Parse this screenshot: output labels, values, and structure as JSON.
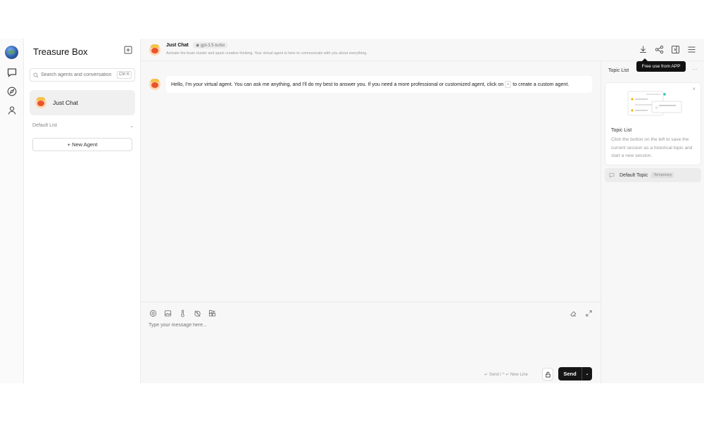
{
  "sidebar": {
    "title": "Treasure Box",
    "search": {
      "placeholder": "Search agents and conversations",
      "shortcut": "Ctrl K"
    },
    "active_session": "Just Chat",
    "group": {
      "label": "Default List"
    },
    "new_agent_label": "+ New Agent"
  },
  "chat": {
    "title": "Just Chat",
    "model": "gpt-3.5-turbo",
    "description": "Activate the brain cluster and spark creative thinking. Your virtual agent is here to communicate with you about everything.",
    "message": {
      "text_before": "Hello, I'm your virtual agent. You can ask me anything, and I'll do my best to answer you. If you need a more professional or customized agent, click on",
      "inline_tag": "+",
      "text_after": "to create a custom agent."
    },
    "input": {
      "placeholder": "Type your message here...",
      "hint": "↵ Send / ^ ↵ New Line",
      "send_label": "Send"
    }
  },
  "toolbar": {
    "tooltip": "Free use from APP"
  },
  "topics": {
    "heading": "Topic List",
    "card": {
      "title": "Topic List",
      "text": "Click the button on the left to save the current session as a historical topic and start a new session."
    },
    "items": [
      {
        "name": "Default Topic",
        "tag": "Temporary"
      }
    ]
  },
  "colors": {
    "send_button": "#161616",
    "active_bg": "#f0f0f0",
    "panel_bg": "#f7f7f7"
  }
}
